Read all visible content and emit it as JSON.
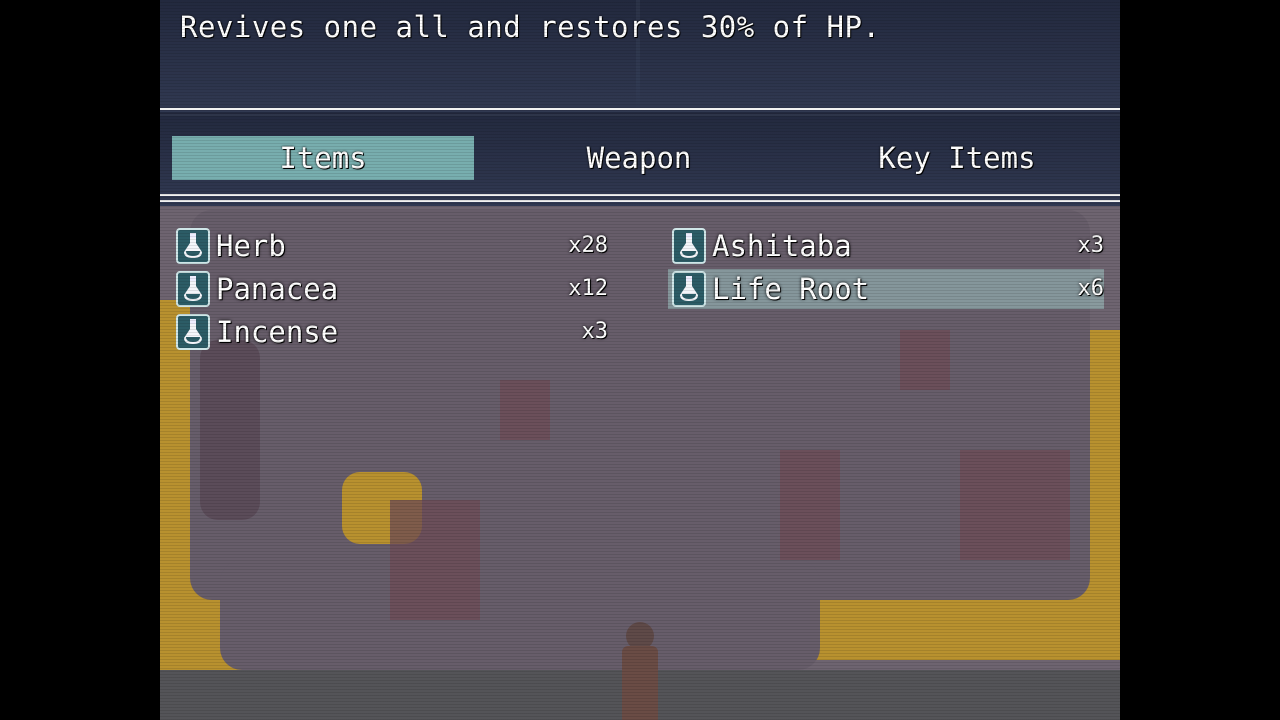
{
  "help": {
    "text": "Revives one all and restores 30% of HP."
  },
  "categories": [
    {
      "label": "Items",
      "selected": true
    },
    {
      "label": "Weapon",
      "selected": false
    },
    {
      "label": "Key Items",
      "selected": false
    }
  ],
  "items": [
    {
      "name": "Herb",
      "qty": "x28",
      "icon": "potion-icon"
    },
    {
      "name": "Ashitaba",
      "qty": "x3",
      "icon": "potion-icon"
    },
    {
      "name": "Panacea",
      "qty": "x12",
      "icon": "potion-icon"
    },
    {
      "name": "Life Root",
      "qty": "x6",
      "icon": "potion-icon",
      "selected": true
    },
    {
      "name": "Incense",
      "qty": "x3",
      "icon": "potion-icon"
    }
  ],
  "colors": {
    "selection": "#8ccdc8",
    "window": "#1c243a",
    "text": "#ffffff"
  }
}
